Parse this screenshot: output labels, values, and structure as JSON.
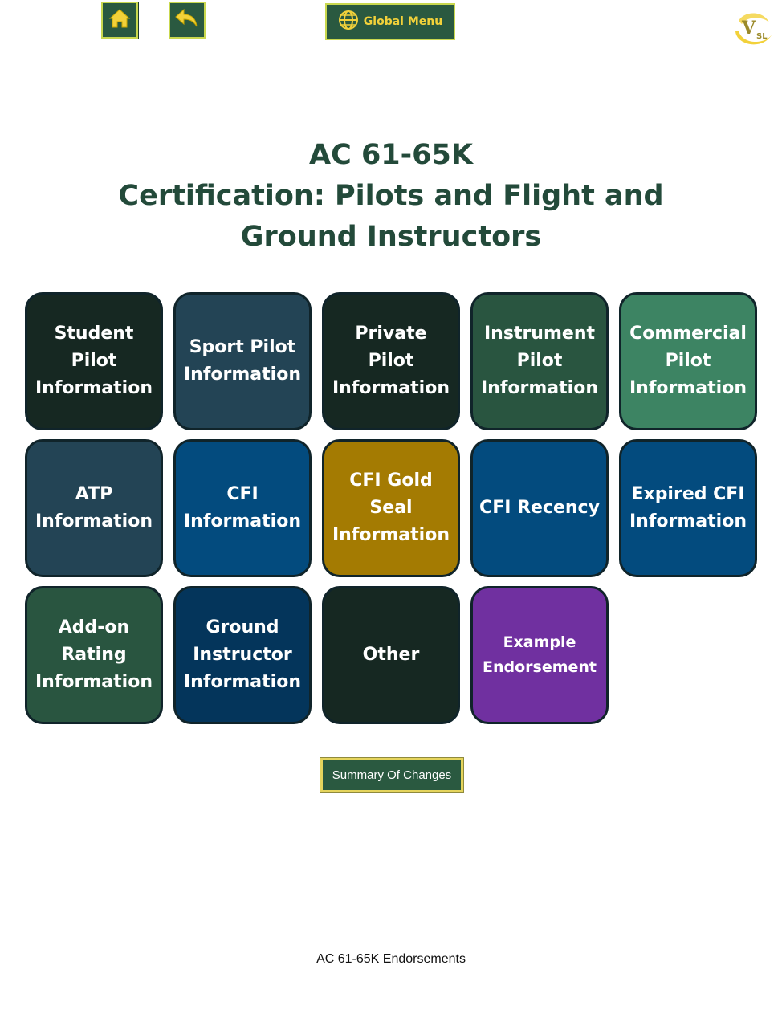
{
  "nav": {
    "home_icon": "home-icon",
    "back_icon": "back-arrow-icon",
    "global_menu_label": "Global Menu",
    "global_menu_icon": "globe-icon"
  },
  "logo": {
    "text": "V",
    "subtext": "SL"
  },
  "title": {
    "line1": "AC 61-65K",
    "line2": "Certification: Pilots and Flight and",
    "line3": "Ground Instructors"
  },
  "tiles": [
    {
      "label": "Student\nPilot\nInformation",
      "color": "#162822"
    },
    {
      "label": "Sport Pilot\nInformation",
      "color": "#234455"
    },
    {
      "label": "Private Pilot\nInformation",
      "color": "#162822"
    },
    {
      "label": "Instrument\nPilot\nInformation",
      "color": "#295540"
    },
    {
      "label": "Commercial\nPilot\nInformation",
      "color": "#3d8463"
    },
    {
      "label": "ATP\nInformation",
      "color": "#234455"
    },
    {
      "label": "CFI\nInformation",
      "color": "#034b7e"
    },
    {
      "label": "CFI Gold\nSeal\nInformation",
      "color": "#a47b02"
    },
    {
      "label": "CFI Recency",
      "color": "#034b7e"
    },
    {
      "label": "Expired CFI\nInformation",
      "color": "#034b7e"
    },
    {
      "label": "Add-on\nRating\nInformation",
      "color": "#295540"
    },
    {
      "label": "Ground\nInstructor\nInformation",
      "color": "#04355b"
    },
    {
      "label": "Other",
      "color": "#162822"
    },
    {
      "label": "Example\nEndorsement",
      "color": "#7030a0"
    }
  ],
  "summary_button_label": "Summary Of Changes",
  "footer_text": "AC 61-65K Endorsements"
}
